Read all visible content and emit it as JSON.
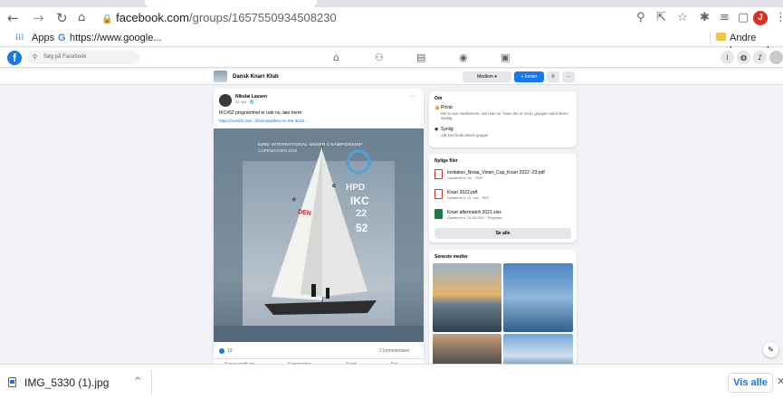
{
  "browser": {
    "url_host": "facebook.com",
    "url_path": "/groups/1657550934508230",
    "profile_initial": "J",
    "bookmarks": {
      "apps": "Apps",
      "google": "https://www.google...",
      "other": "Andre bogmærke"
    }
  },
  "facebook": {
    "search_placeholder": "Søg på Facebook",
    "group_name": "Dansk Knarr Klub",
    "members_button": "Medlem",
    "invite_button": "+ Inviter",
    "more_button": "···"
  },
  "post": {
    "author": "Nikolai Lassen",
    "time": "26. jan · 🌐",
    "text": "IKC#52 programmet er ude nu, læs mere:",
    "link": "https://mailchi.mp/.../final-deadline-on-the-ikc52...",
    "poster_title": "52ND INTERNATIONAL KNARR CHAMPIONSHIP",
    "poster_subtitle": "COPENHAGEN 2022",
    "poster_side_1": "HPD",
    "poster_side_2": "IKC",
    "poster_side_3": "22",
    "poster_side_4": "52",
    "sail_number": "DEN",
    "reactions_count": "19",
    "comments": "2 kommentarer",
    "actions": [
      "Synes godt om",
      "Kommenter",
      "Send",
      "Del"
    ]
  },
  "about": {
    "title": "Om",
    "private_title": "Privat",
    "private_desc": "Det er kun medlemmer, som kan se, hvem der er med i gruppen samt deres opslag.",
    "visible_title": "Synlig",
    "visible_desc": "Alle kan finde denne gruppe."
  },
  "files": {
    "title": "Nylige filer",
    "items": [
      {
        "name": "Invitation_Nivaa_Vinter_Cup_Knarr 2022 -23.pdf",
        "meta": "Opdateret d. On. · PDF"
      },
      {
        "name": "Knarr 2022.pdf",
        "meta": "Opdateret d. 24. nov. · PDF"
      },
      {
        "name": "Knarr aftermatch 2021.xlsx",
        "meta": "Opdateret d. 11-08-2021 · Regneark"
      }
    ],
    "see_all": "Se alle"
  },
  "media": {
    "title": "Seneste medier"
  },
  "download": {
    "filename": "IMG_5330 (1).jpg",
    "show_all": "Vis alle"
  },
  "colors": {
    "facebook_blue": "#1877f2",
    "chrome_blue": "#1a73e8",
    "poster_bg": "#6f8596"
  }
}
